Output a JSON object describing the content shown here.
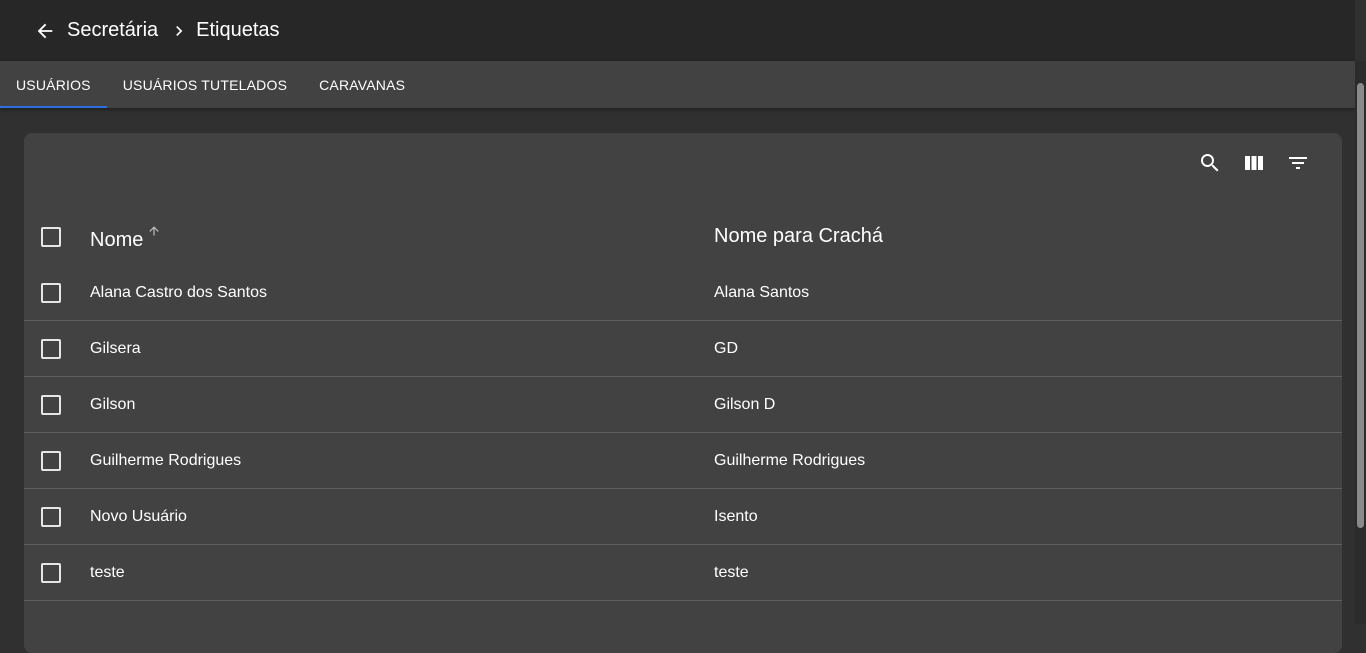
{
  "breadcrumb": {
    "parent": "Secretária",
    "current": "Etiquetas"
  },
  "tabs": [
    {
      "label": "USUÁRIOS",
      "active": true
    },
    {
      "label": "USUÁRIOS TUTELADOS",
      "active": false
    },
    {
      "label": "CARAVANAS",
      "active": false
    }
  ],
  "table": {
    "columns": [
      "Nome",
      "Nome para Crachá"
    ],
    "sort": {
      "column": "Nome",
      "direction": "asc"
    },
    "rows": [
      [
        "Alana Castro dos Santos",
        "Alana Santos"
      ],
      [
        "Gilsera",
        "GD"
      ],
      [
        "Gilson",
        "Gilson D"
      ],
      [
        "Guilherme Rodrigues",
        "Guilherme Rodrigues"
      ],
      [
        "Novo Usuário",
        "Isento"
      ],
      [
        "teste",
        "teste"
      ]
    ]
  },
  "toolbar_icons": [
    "search-icon",
    "view-columns-icon",
    "filter-icon"
  ],
  "colors": {
    "appbar": "#272727",
    "tabs": "#424242",
    "background": "#303030",
    "card": "#424242",
    "tab_indicator": "#2f6fdc"
  }
}
